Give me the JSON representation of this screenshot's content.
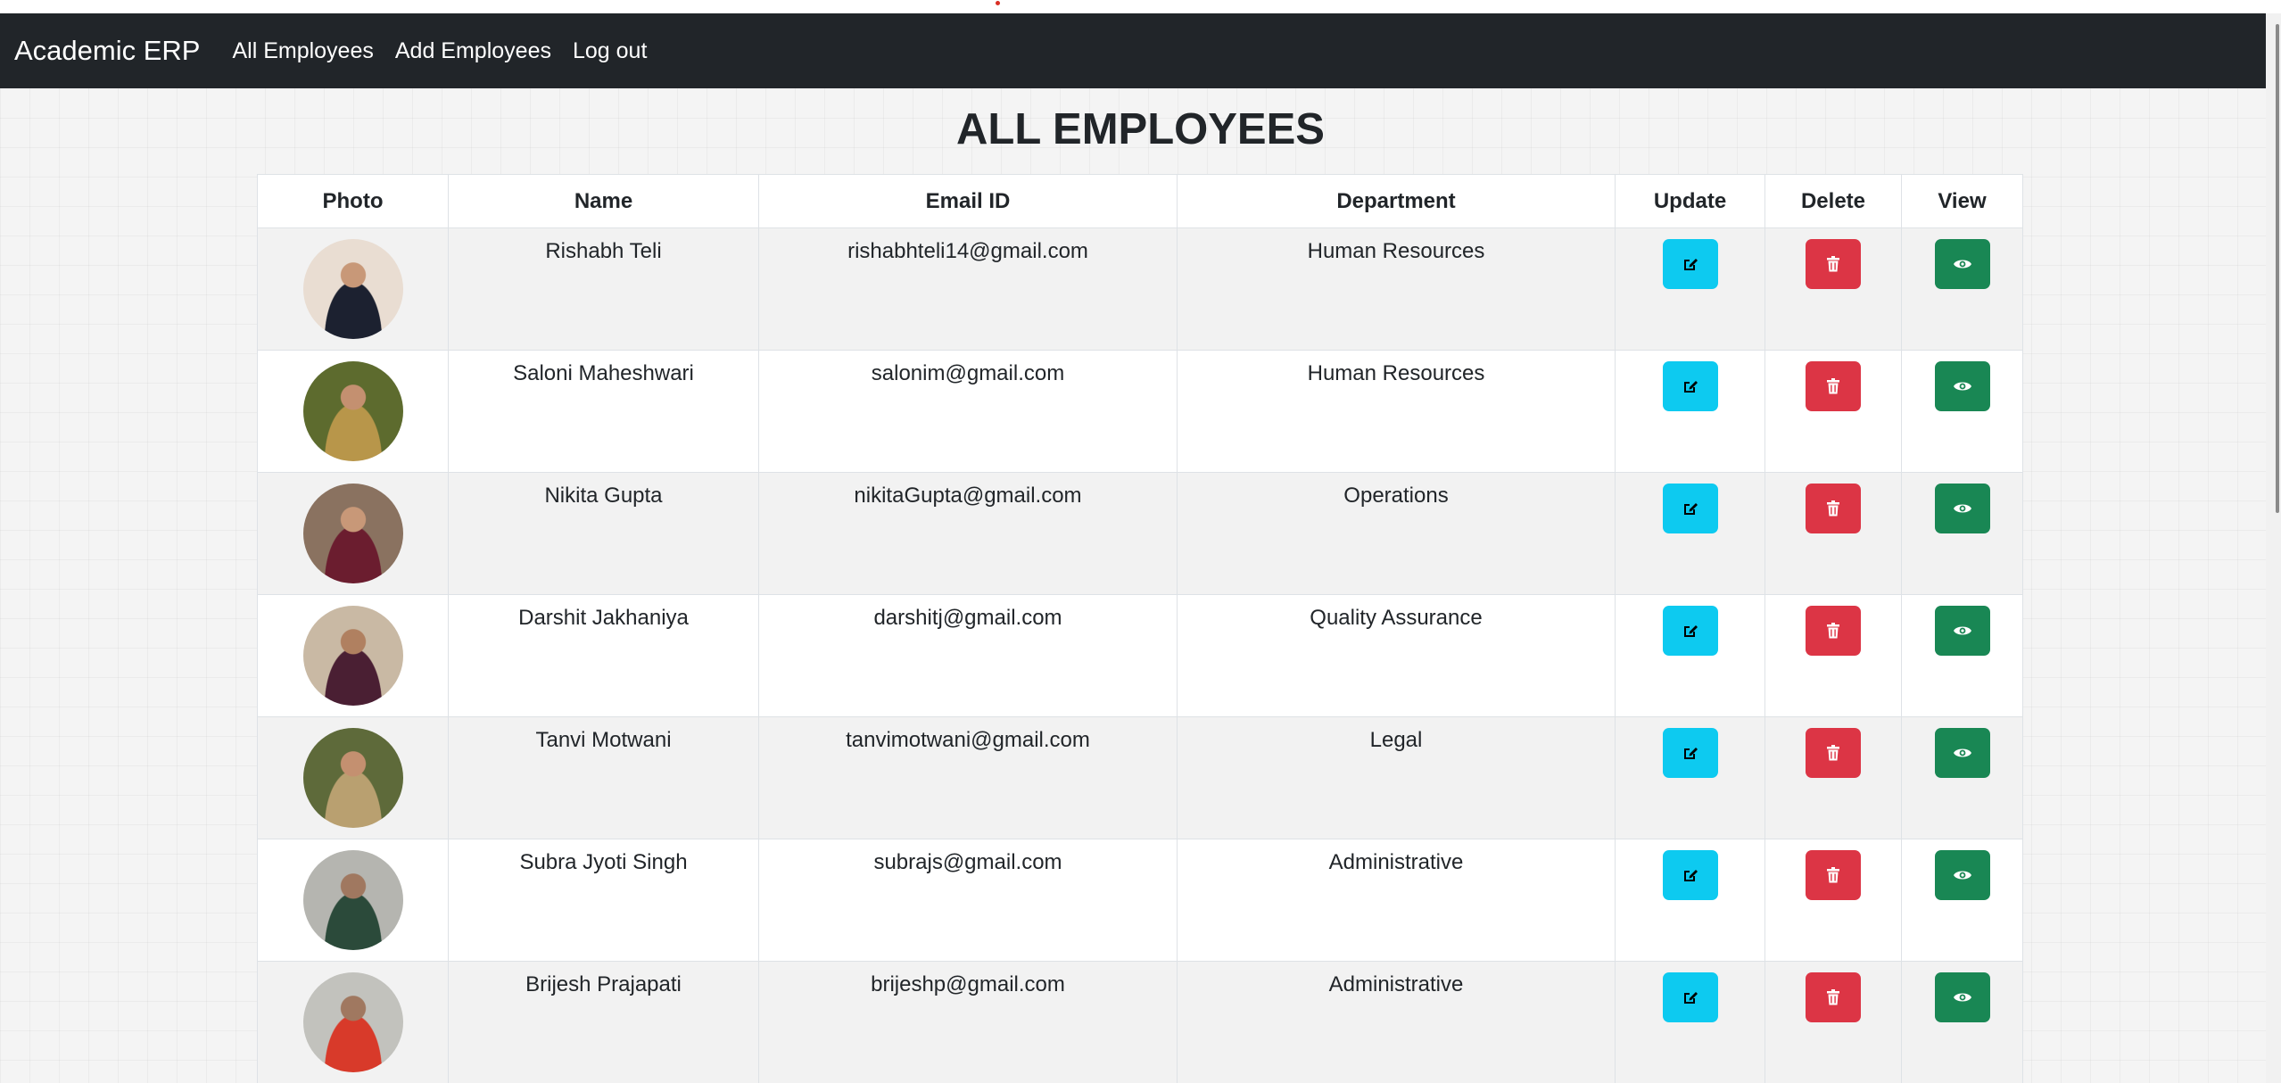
{
  "navbar": {
    "brand": "Academic ERP",
    "links": [
      "All Employees",
      "Add Employees",
      "Log out"
    ]
  },
  "page": {
    "title": "ALL EMPLOYEES"
  },
  "table": {
    "headers": [
      "Photo",
      "Name",
      "Email ID",
      "Department",
      "Update",
      "Delete",
      "View"
    ],
    "rows": [
      {
        "name": "Rishabh Teli",
        "email": "rishabhteli14@gmail.com",
        "department": "Human Resources"
      },
      {
        "name": "Saloni Maheshwari",
        "email": "salonim@gmail.com",
        "department": "Human Resources"
      },
      {
        "name": "Nikita Gupta",
        "email": "nikitaGupta@gmail.com",
        "department": "Operations"
      },
      {
        "name": "Darshit Jakhaniya",
        "email": "darshitj@gmail.com",
        "department": "Quality Assurance"
      },
      {
        "name": "Tanvi Motwani",
        "email": "tanvimotwani@gmail.com",
        "department": "Legal"
      },
      {
        "name": "Subra Jyoti Singh",
        "email": "subrajs@gmail.com",
        "department": "Administrative"
      },
      {
        "name": "Brijesh Prajapati",
        "email": "brijeshp@gmail.com",
        "department": "Administrative"
      }
    ]
  },
  "icons": {
    "update": "edit-icon",
    "delete": "trash-icon",
    "view": "eye-icon"
  },
  "colors": {
    "navbar": "#212529",
    "update_button": "#0dcaf0",
    "delete_button": "#dc3545",
    "view_button": "#198754"
  }
}
